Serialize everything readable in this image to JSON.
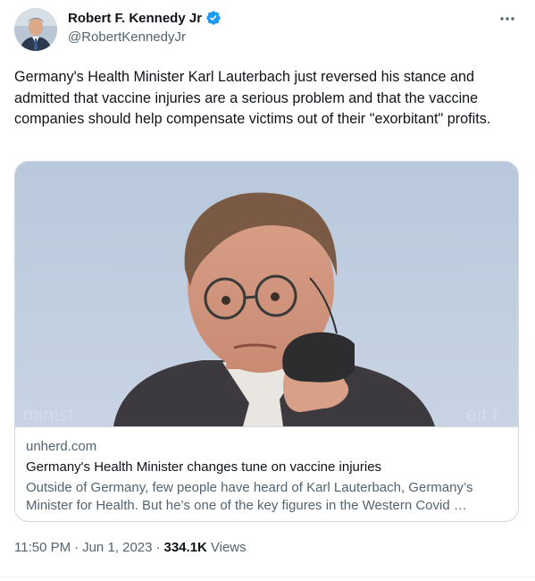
{
  "author": {
    "name": "Robert F. Kennedy Jr",
    "handle": "@RobertKennedyJr",
    "verified": true
  },
  "tweet": {
    "text": "Germany's Health Minister Karl Lauterbach just reversed his stance and admitted that vaccine injuries are a serious problem and that the vaccine companies should help compensate victims out of their \"exorbitant\" profits."
  },
  "card": {
    "domain": "unherd.com",
    "title": "Germany's Health Minister changes tune on vaccine injuries",
    "description": "Outside of Germany, few people have heard of Karl Lauterbach, Germany’s Minister for Health. But he’s one of the key figures in the Western Covid …"
  },
  "meta": {
    "time": "11:50 PM",
    "separator": "·",
    "date": "Jun 1, 2023",
    "views_count": "334.1K",
    "views_label": "Views"
  },
  "icons": {
    "verified": "verified-badge-icon",
    "more": "more-options-icon"
  },
  "colors": {
    "verified_blue": "#1d9bf0",
    "secondary_text": "#536471",
    "primary_text": "#0f1419",
    "border": "#cfd9de"
  }
}
